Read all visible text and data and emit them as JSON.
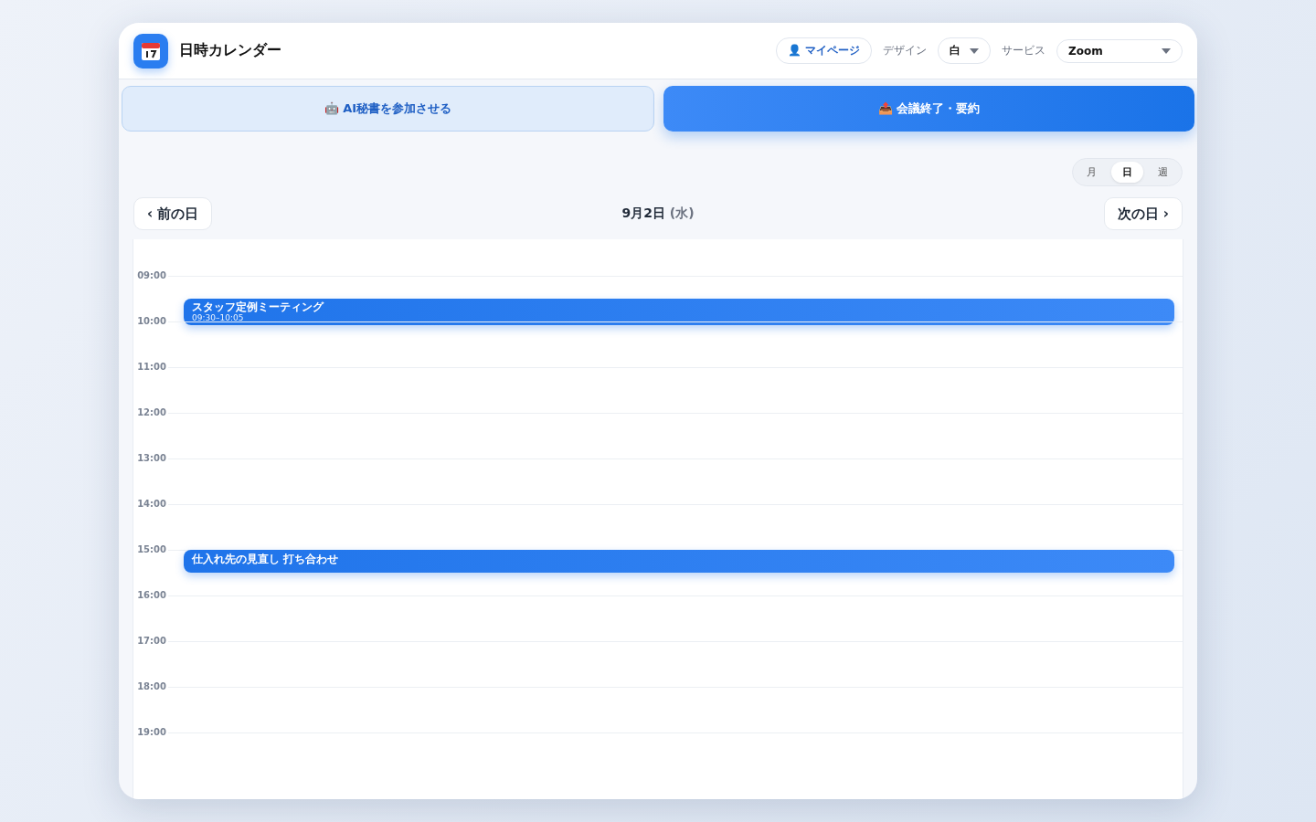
{
  "app": {
    "title": "日時カレンダー"
  },
  "header": {
    "mypage": "👤 マイページ",
    "design_label": "デザイン",
    "design_value": "白",
    "service_label": "サービス",
    "service_value": "Zoom"
  },
  "actions": [
    {
      "label": "🤖 AI秘書を参加させる",
      "kind": "secondary"
    },
    {
      "label": "📤 会議終了・要約",
      "kind": "primary"
    }
  ],
  "views": [
    {
      "label": "月",
      "selected": false
    },
    {
      "label": "日",
      "selected": true
    },
    {
      "label": "週",
      "selected": false
    }
  ],
  "nav": {
    "prev": "‹ 前の日",
    "date": "9月2日",
    "weekday": "(水)",
    "next": "次の日 ›"
  },
  "hours": [
    {
      "label": "09:00",
      "events": [
        {
          "title": "スタッフ定例ミーティング",
          "time": "09:30–10:05",
          "kind": "halfpast"
        }
      ]
    },
    {
      "label": "10:00"
    },
    {
      "label": "11:00"
    },
    {
      "label": "12:00"
    },
    {
      "label": "13:00"
    },
    {
      "label": "14:00"
    },
    {
      "label": "15:00",
      "events": [
        {
          "title": "仕入れ先の見直し 打ち合わせ",
          "kind": "onhour"
        }
      ]
    },
    {
      "label": "16:00"
    },
    {
      "label": "17:00"
    },
    {
      "label": "18:00"
    },
    {
      "label": "19:00"
    }
  ]
}
